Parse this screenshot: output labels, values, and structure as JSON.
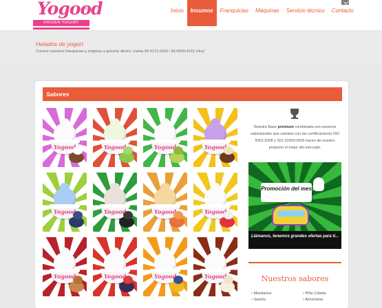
{
  "header": {
    "logo_text": "Yogood",
    "logo_tagline": "FROZEN YOGURT",
    "logo_reg": "®",
    "nav": [
      "Inicio",
      "Insumos",
      "Franquicias",
      "Máquinas",
      "Servicio técnico",
      "Contacto"
    ],
    "active_nav": "Insumos",
    "mail_icon": "envelope-icon"
  },
  "band": {
    "title": "Helados de yogurt",
    "subtitle": "Conoce nuestras franquicias y empieza a generar dinero. Llama 55-5171-0432 / 55-6839-4310 ¡Hoy!"
  },
  "sabores": {
    "title": "Sabores",
    "tiles": [
      {
        "name": "coco",
        "ray": "#d86bd6",
        "ray2": "#ffffff",
        "swirl": "#fbfbfb",
        "fruit": "#7a4b2a",
        "fruit2": "#ffffff"
      },
      {
        "name": "manzana",
        "ray": "#e0513a",
        "ray2": "#ffffff",
        "swirl": "#eef7e0",
        "fruit": "#8bc94a",
        "fruit2": "#a8d76a"
      },
      {
        "name": "pera",
        "ray": "#43b649",
        "ray2": "#ffffff",
        "swirl": "#fbfbfb",
        "fruit": "#b5d35a",
        "fruit2": "#8fb83a"
      },
      {
        "name": "taro",
        "ray": "#f2c21b",
        "ray2": "#ffffff",
        "swirl": "#c9a0e8",
        "fruit": "#6b3a22",
        "fruit2": "#f0e0c0"
      },
      {
        "name": "mora-azul",
        "ray": "#9fcf3c",
        "ray2": "#ffffff",
        "swirl": "#a9cdf4",
        "fruit": "#2c3a6a",
        "fruit2": "#3d4d85"
      },
      {
        "name": "oreo",
        "ray": "#2e9d3b",
        "ray2": "#ffffff",
        "swirl": "#e8e2da",
        "fruit": "#222222",
        "fruit2": "#3a3a3a"
      },
      {
        "name": "durazno",
        "ray": "#e9a03a",
        "ray2": "#ffffff",
        "swirl": "#f5d7a0",
        "fruit": "#e6733b",
        "fruit2": "#f19a57"
      },
      {
        "name": "lichi",
        "ray": "#f0c91f",
        "ray2": "#ffffff",
        "swirl": "#fbfbfb",
        "fruit": "#e2333d",
        "fruit2": "#f1f1f1"
      },
      {
        "name": "almendra",
        "ray": "#b8222b",
        "ray2": "#ffffff",
        "swirl": "#fbfbfb",
        "fruit": "#c8864b",
        "fruit2": "#b87235"
      },
      {
        "name": "frutos-rojos",
        "ray": "#d9342b",
        "ray2": "#ffffff",
        "swirl": "#fbfbfb",
        "fruit": "#3a2a55",
        "fruit2": "#e23a3a"
      },
      {
        "name": "mango",
        "ray": "#f39a1c",
        "ray2": "#ffffff",
        "swirl": "#fbfbfb",
        "fruit": "#f2b822",
        "fruit2": "#3b4e91"
      },
      {
        "name": "chocolate-blanco",
        "ray": "#8a2d18",
        "ray2": "#ffffff",
        "swirl": "#fbfbfb",
        "fruit": "#f7efdf",
        "fruit2": "#efe5cf"
      }
    ]
  },
  "aside": {
    "trophy_icon": "trophy-icon",
    "description_pre": "Nuestra Base ",
    "description_bold": "premium",
    "description_post": " combinada con nuestros saborizantes que cuentan con las certificaciones ISO 9001:2008 y ISO 22000:2005 hacen de nuestro producto el mejor del mercado.",
    "promo_title": "Promoción del mes",
    "promo_caption": "Llámanos, tenemos grandes ofertas para ti...",
    "section_title": "Nuestros sabores",
    "flavors_left": [
      "Mandarina",
      "Sandía"
    ],
    "flavors_right": [
      "Piña Colada",
      "Almendras"
    ]
  }
}
